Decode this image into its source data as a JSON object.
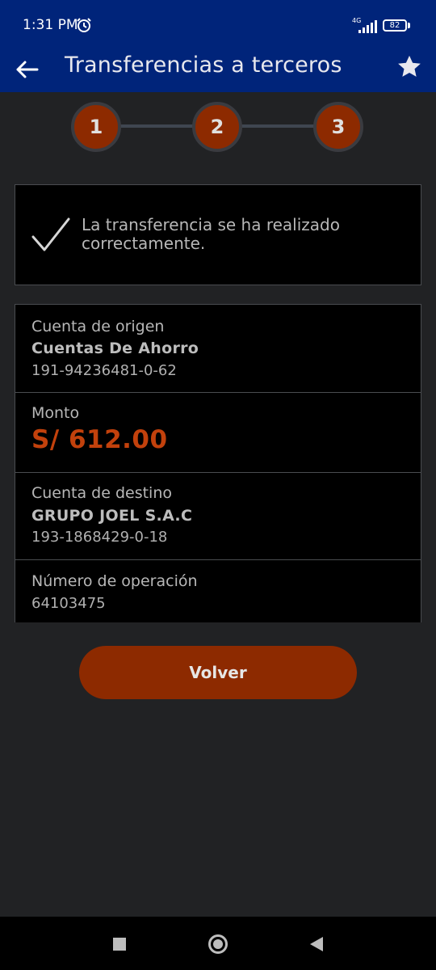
{
  "status_bar": {
    "time": "1:31 PM",
    "network": "4G",
    "battery": "82"
  },
  "app_bar": {
    "title": "Transferencias a terceros"
  },
  "stepper": {
    "steps": [
      "1",
      "2",
      "3"
    ],
    "active_step": 3
  },
  "success": {
    "message": "La transferencia se ha realizado correctamente."
  },
  "details": {
    "origin_label": "Cuenta de origen",
    "origin_type": "Cuentas De Ahorro",
    "origin_number": "191-94236481-0-62",
    "amount_label": "Monto",
    "amount": "S/ 612.00",
    "destination_label": "Cuenta de destino",
    "destination_name": "GRUPO JOEL S.A.C",
    "destination_number": "193-1868429-0-18",
    "operation_label": "Número de operación",
    "operation_number": "64103475"
  },
  "actions": {
    "back_label": "Volver"
  },
  "colors": {
    "header": "#00247a",
    "accent": "#8d2a00",
    "amount": "#c2410c",
    "background": "#212224"
  }
}
